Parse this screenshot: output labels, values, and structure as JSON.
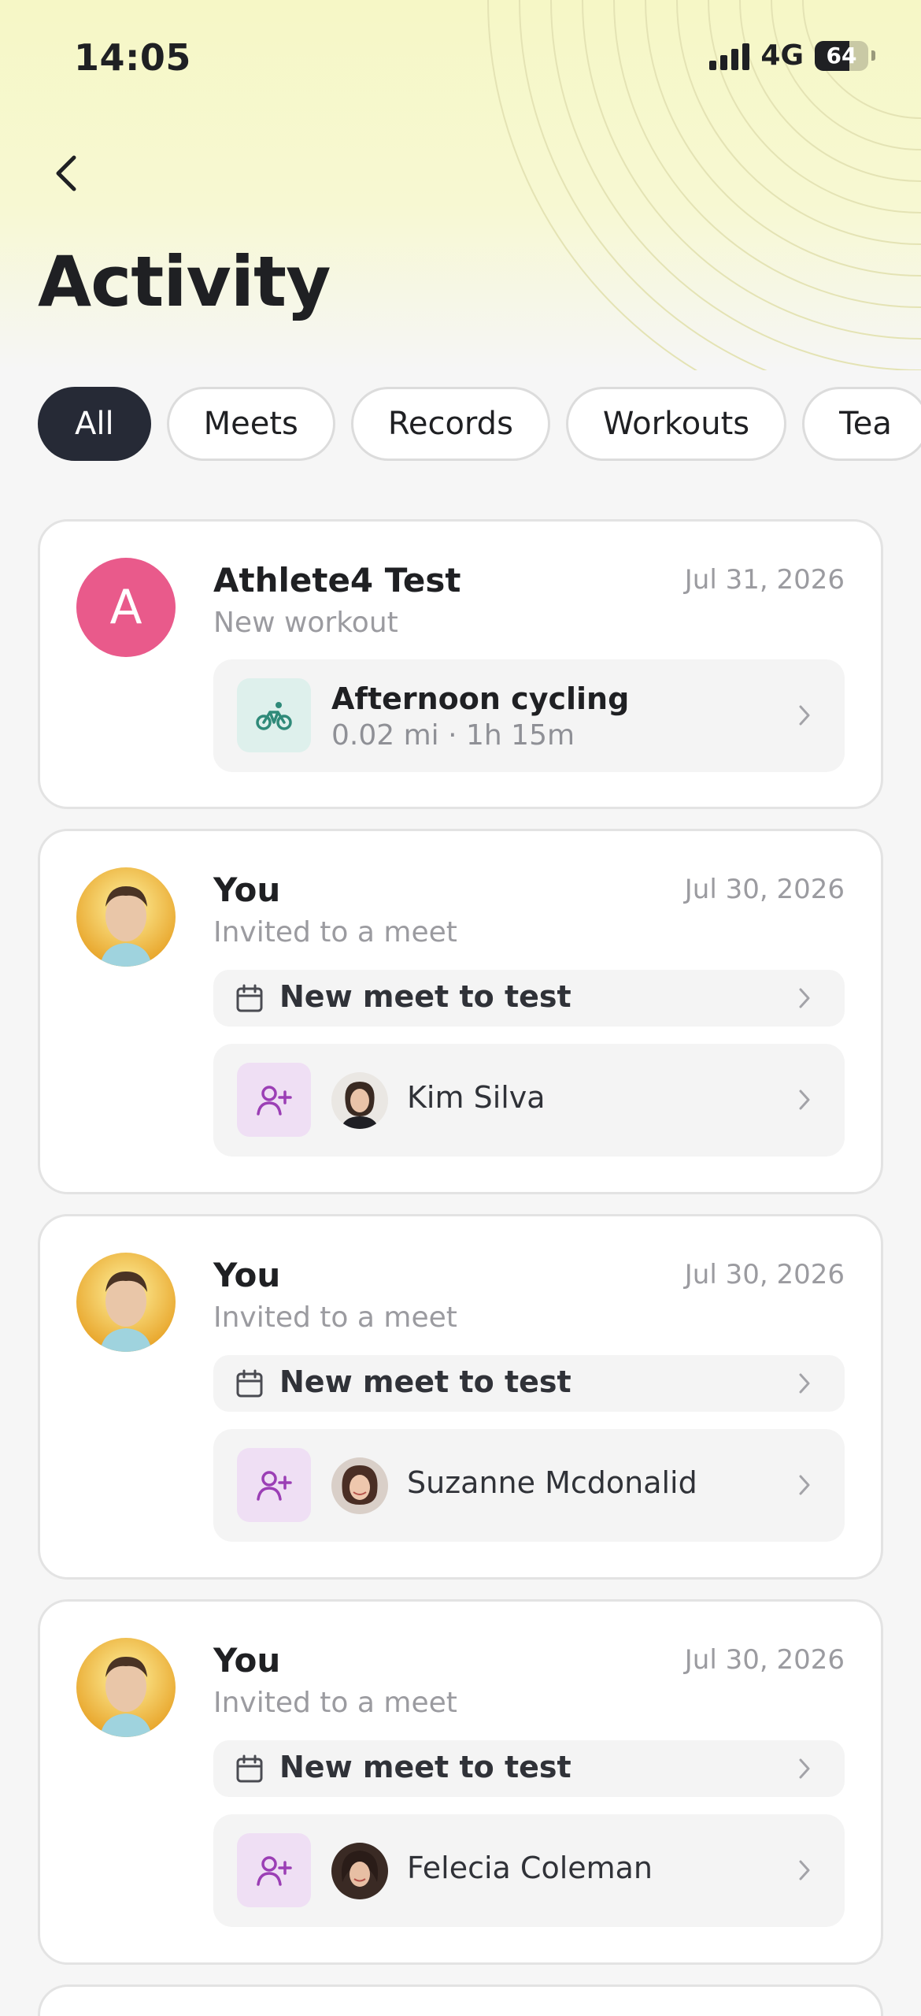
{
  "status_bar": {
    "time": "14:05",
    "network": "4G",
    "battery": "64"
  },
  "header": {
    "title": "Activity"
  },
  "tabs": [
    {
      "label": "All",
      "active": true
    },
    {
      "label": "Meets",
      "active": false
    },
    {
      "label": "Records",
      "active": false
    },
    {
      "label": "Workouts",
      "active": false
    },
    {
      "label": "Tea",
      "active": false
    }
  ],
  "feed": [
    {
      "user": "Athlete4 Test",
      "avatar_letter": "A",
      "action": "New workout",
      "date": "Jul 31, 2026",
      "workout": {
        "title": "Afternoon cycling",
        "meta": "0.02 mi · 1h 15m",
        "icon": "bike-icon"
      }
    },
    {
      "user": "You",
      "action": "Invited to a meet",
      "date": "Jul 30, 2026",
      "meet": "New meet to test",
      "invitee": "Kim Silva"
    },
    {
      "user": "You",
      "action": "Invited to a meet",
      "date": "Jul 30, 2026",
      "meet": "New meet to test",
      "invitee": "Suzanne Mcdonalid"
    },
    {
      "user": "You",
      "action": "Invited to a meet",
      "date": "Jul 30, 2026",
      "meet": "New meet to test",
      "invitee": "Felecia Coleman"
    }
  ],
  "colors": {
    "accent_dark": "#262a36",
    "avatar_pink": "#e95a8b",
    "workout_tint": "#def0ec",
    "invite_tint": "#efdff4"
  }
}
